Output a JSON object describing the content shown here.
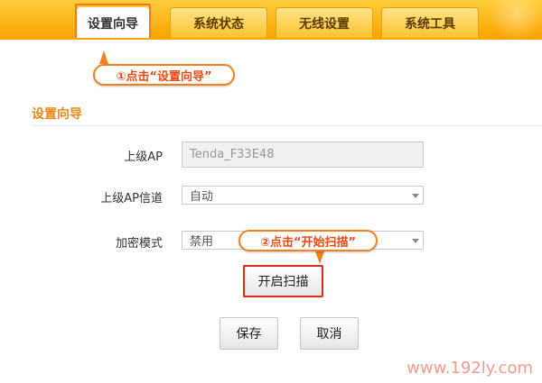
{
  "tabs": [
    {
      "label": "设置向导",
      "active": true
    },
    {
      "label": "系统状态",
      "active": false
    },
    {
      "label": "无线设置",
      "active": false
    },
    {
      "label": "系统工具",
      "active": false
    }
  ],
  "annotations": {
    "step1": "①点击“设置向导”",
    "step2": "②点击“开始扫描”"
  },
  "section": {
    "title": "设置向导"
  },
  "form": {
    "upper_ap": {
      "label": "上级AP",
      "value": "Tenda_F33E48"
    },
    "upper_ap_channel": {
      "label": "上级AP信道",
      "value": "自动"
    },
    "encryption": {
      "label": "加密模式",
      "value": "禁用"
    }
  },
  "buttons": {
    "scan": "开启扫描",
    "save": "保存",
    "cancel": "取消"
  },
  "watermark": "www.192ly.com",
  "colors": {
    "accent": "#f9a400",
    "highlight": "#f3801f",
    "annotation_text": "#e84b14"
  }
}
